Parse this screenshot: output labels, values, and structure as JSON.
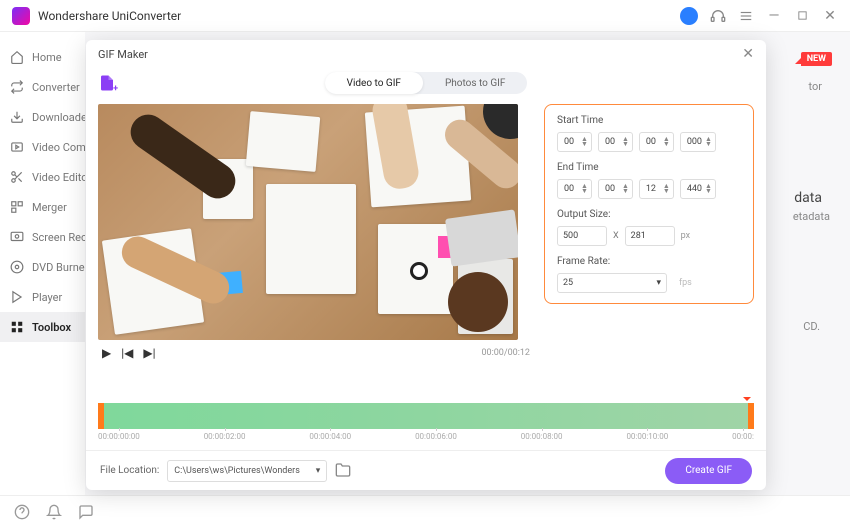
{
  "app": {
    "title": "Wondershare UniConverter"
  },
  "sidebar": {
    "items": [
      {
        "label": "Home"
      },
      {
        "label": "Converter"
      },
      {
        "label": "Downloader"
      },
      {
        "label": "Video Compressor"
      },
      {
        "label": "Video Editor"
      },
      {
        "label": "Merger"
      },
      {
        "label": "Screen Recorder"
      },
      {
        "label": "DVD Burner"
      },
      {
        "label": "Player"
      },
      {
        "label": "Toolbox"
      }
    ]
  },
  "badge": {
    "new": "NEW"
  },
  "background_hints": {
    "tor": "tor",
    "data": "data",
    "etadata": "etadata",
    "cd": "CD."
  },
  "modal": {
    "title": "GIF Maker",
    "tabs": {
      "video": "Video to GIF",
      "photos": "Photos to GIF"
    },
    "playback": {
      "time": "00:00/00:12"
    },
    "settings": {
      "start_label": "Start Time",
      "start": [
        "00",
        "00",
        "00",
        "000"
      ],
      "end_label": "End Time",
      "end": [
        "00",
        "00",
        "12",
        "440"
      ],
      "output_label": "Output Size:",
      "width": "500",
      "height": "281",
      "px": "px",
      "frame_label": "Frame Rate:",
      "frame_rate": "25",
      "fps": "fps"
    },
    "timeline": {
      "ticks": [
        "00:00:00:00",
        "00:00:02:00",
        "00:00:04:00",
        "00:00:06:00",
        "00:00:08:00",
        "00:00:10:00",
        "00:00:"
      ]
    },
    "footer": {
      "label": "File Location:",
      "path": "C:\\Users\\ws\\Pictures\\Wonders",
      "create": "Create GIF"
    }
  }
}
